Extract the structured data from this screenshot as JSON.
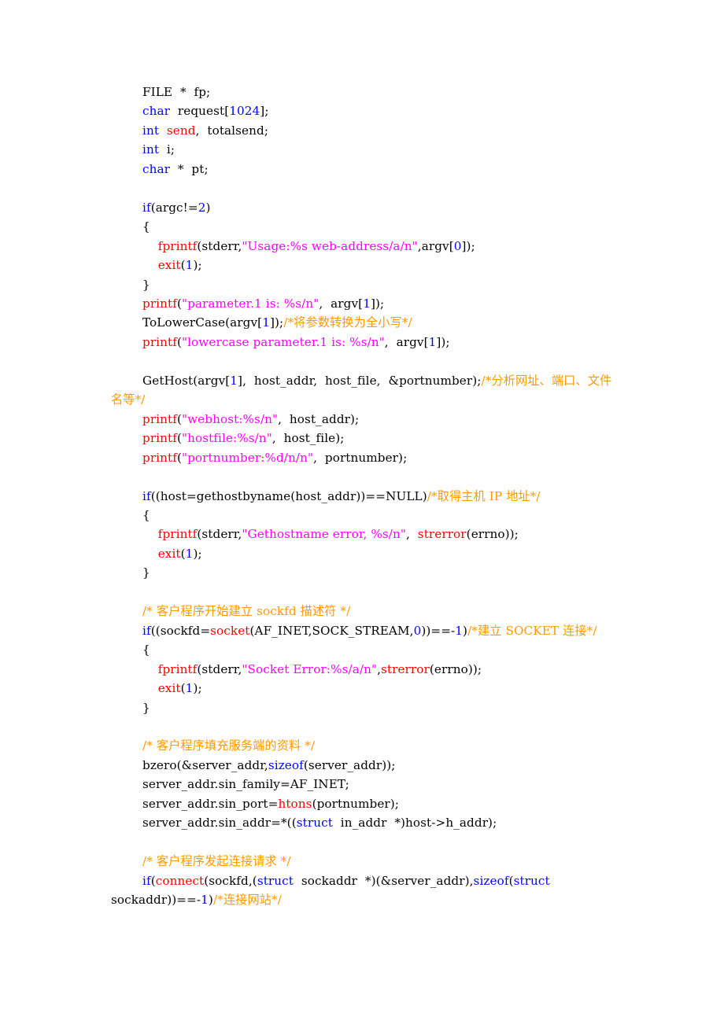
{
  "document": {
    "type": "c-source-code-listing",
    "language": "C",
    "colors": {
      "background": "#ffffff",
      "plain": "#000000",
      "keyword": "#0000ff",
      "function": "#ff0000",
      "string": "#ff00ff",
      "number": "#0000ff",
      "comment": "#ff9900",
      "constant": "#ff0000"
    }
  },
  "code": {
    "lines": [
      {
        "id": "l01",
        "tokens": [
          {
            "text": "FILE",
            "type": "const"
          },
          {
            "text": "  *  fp;",
            "type": "plain"
          }
        ]
      },
      {
        "id": "l02",
        "tokens": [
          {
            "text": "char",
            "type": "kw"
          },
          {
            "text": "  request[",
            "type": "plain"
          },
          {
            "text": "1024",
            "type": "num"
          },
          {
            "text": "];",
            "type": "plain"
          }
        ]
      },
      {
        "id": "l03",
        "tokens": [
          {
            "text": "int",
            "type": "kw"
          },
          {
            "text": "  ",
            "type": "plain"
          },
          {
            "text": "send",
            "type": "fn"
          },
          {
            "text": ",  totalsend;",
            "type": "plain"
          }
        ]
      },
      {
        "id": "l04",
        "tokens": [
          {
            "text": "int",
            "type": "kw"
          },
          {
            "text": "  i;",
            "type": "plain"
          }
        ]
      },
      {
        "id": "l05",
        "tokens": [
          {
            "text": "char",
            "type": "kw"
          },
          {
            "text": "  *  pt;",
            "type": "plain"
          }
        ]
      },
      {
        "id": "l06",
        "blank": true,
        "tokens": []
      },
      {
        "id": "l07",
        "tokens": [
          {
            "text": "if",
            "type": "kw"
          },
          {
            "text": "(argc!=",
            "type": "plain"
          },
          {
            "text": "2",
            "type": "num"
          },
          {
            "text": ")",
            "type": "plain"
          }
        ]
      },
      {
        "id": "l08",
        "tokens": [
          {
            "text": "{",
            "type": "plain"
          }
        ]
      },
      {
        "id": "l09",
        "tokens": [
          {
            "text": "    ",
            "type": "plain"
          },
          {
            "text": "fprintf",
            "type": "fn"
          },
          {
            "text": "(stderr,",
            "type": "plain"
          },
          {
            "text": "\"Usage:%s web-address/a/n\"",
            "type": "str"
          },
          {
            "text": ",argv[",
            "type": "plain"
          },
          {
            "text": "0",
            "type": "num"
          },
          {
            "text": "]);",
            "type": "plain"
          }
        ]
      },
      {
        "id": "l10",
        "tokens": [
          {
            "text": "    ",
            "type": "plain"
          },
          {
            "text": "exit",
            "type": "fn"
          },
          {
            "text": "(",
            "type": "plain"
          },
          {
            "text": "1",
            "type": "num"
          },
          {
            "text": ");",
            "type": "plain"
          }
        ]
      },
      {
        "id": "l11",
        "tokens": [
          {
            "text": "}",
            "type": "plain"
          }
        ]
      },
      {
        "id": "l12",
        "tokens": [
          {
            "text": "printf",
            "type": "fn"
          },
          {
            "text": "(",
            "type": "plain"
          },
          {
            "text": "\"parameter.1 is: %s/n\"",
            "type": "str"
          },
          {
            "text": ",  argv[",
            "type": "plain"
          },
          {
            "text": "1",
            "type": "num"
          },
          {
            "text": "]);",
            "type": "plain"
          }
        ]
      },
      {
        "id": "l13",
        "tokens": [
          {
            "text": "ToLowerCase(argv[",
            "type": "plain"
          },
          {
            "text": "1",
            "type": "num"
          },
          {
            "text": "]);",
            "type": "plain"
          },
          {
            "text": "/*将参数转换为全小写*/",
            "type": "comment"
          }
        ]
      },
      {
        "id": "l14",
        "tokens": [
          {
            "text": "printf",
            "type": "fn"
          },
          {
            "text": "(",
            "type": "plain"
          },
          {
            "text": "\"lowercase parameter.1 is: %s/n\"",
            "type": "str"
          },
          {
            "text": ",  argv[",
            "type": "plain"
          },
          {
            "text": "1",
            "type": "num"
          },
          {
            "text": "]);",
            "type": "plain"
          }
        ]
      },
      {
        "id": "l15",
        "blank": true,
        "tokens": []
      },
      {
        "id": "l16",
        "tokens": [
          {
            "text": "GetHost(argv[",
            "type": "plain"
          },
          {
            "text": "1",
            "type": "num"
          },
          {
            "text": "],  host_addr,  host_file,  &portnumber);",
            "type": "plain"
          },
          {
            "text": "/*分析网址、端口、文件名等*/",
            "type": "comment"
          }
        ]
      },
      {
        "id": "l17",
        "tokens": [
          {
            "text": "printf",
            "type": "fn"
          },
          {
            "text": "(",
            "type": "plain"
          },
          {
            "text": "\"webhost:%s/n\"",
            "type": "str"
          },
          {
            "text": ",  host_addr);",
            "type": "plain"
          }
        ]
      },
      {
        "id": "l18",
        "tokens": [
          {
            "text": "printf",
            "type": "fn"
          },
          {
            "text": "(",
            "type": "plain"
          },
          {
            "text": "\"hostfile:%s/n\"",
            "type": "str"
          },
          {
            "text": ",  host_file);",
            "type": "plain"
          }
        ]
      },
      {
        "id": "l19",
        "tokens": [
          {
            "text": "printf",
            "type": "fn"
          },
          {
            "text": "(",
            "type": "plain"
          },
          {
            "text": "\"portnumber:%d/n/n\"",
            "type": "str"
          },
          {
            "text": ",  portnumber);",
            "type": "plain"
          }
        ]
      },
      {
        "id": "l20",
        "blank": true,
        "tokens": []
      },
      {
        "id": "l21",
        "tokens": [
          {
            "text": "if",
            "type": "kw"
          },
          {
            "text": "((host=gethostbyname(host_addr))==",
            "type": "plain"
          },
          {
            "text": "NULL",
            "type": "const"
          },
          {
            "text": ")",
            "type": "plain"
          },
          {
            "text": "/*取得主机 IP 地址*/",
            "type": "comment"
          }
        ]
      },
      {
        "id": "l22",
        "tokens": [
          {
            "text": "{",
            "type": "plain"
          }
        ]
      },
      {
        "id": "l23",
        "tokens": [
          {
            "text": "    ",
            "type": "plain"
          },
          {
            "text": "fprintf",
            "type": "fn"
          },
          {
            "text": "(stderr,",
            "type": "plain"
          },
          {
            "text": "\"Gethostname error, %s/n\"",
            "type": "str"
          },
          {
            "text": ",  ",
            "type": "plain"
          },
          {
            "text": "strerror",
            "type": "fn"
          },
          {
            "text": "(errno));",
            "type": "plain"
          }
        ]
      },
      {
        "id": "l24",
        "tokens": [
          {
            "text": "    ",
            "type": "plain"
          },
          {
            "text": "exit",
            "type": "fn"
          },
          {
            "text": "(",
            "type": "plain"
          },
          {
            "text": "1",
            "type": "num"
          },
          {
            "text": ");",
            "type": "plain"
          }
        ]
      },
      {
        "id": "l25",
        "tokens": [
          {
            "text": "}",
            "type": "plain"
          }
        ]
      },
      {
        "id": "l26",
        "blank": true,
        "tokens": []
      },
      {
        "id": "l27",
        "tokens": [
          {
            "text": "/* 客户程序开始建立 sockfd 描述符 */",
            "type": "comment"
          }
        ]
      },
      {
        "id": "l28",
        "tokens": [
          {
            "text": "if",
            "type": "kw"
          },
          {
            "text": "((sockfd=",
            "type": "plain"
          },
          {
            "text": "socket",
            "type": "fn"
          },
          {
            "text": "(",
            "type": "plain"
          },
          {
            "text": "AF_INET",
            "type": "const"
          },
          {
            "text": ",",
            "type": "plain"
          },
          {
            "text": "SOCK_STREAM",
            "type": "const"
          },
          {
            "text": ",",
            "type": "plain"
          },
          {
            "text": "0",
            "type": "num"
          },
          {
            "text": "))==-",
            "type": "plain"
          },
          {
            "text": "1",
            "type": "num"
          },
          {
            "text": ")",
            "type": "plain"
          },
          {
            "text": "/*建立 SOCKET 连接*/",
            "type": "comment"
          }
        ]
      },
      {
        "id": "l29",
        "tokens": [
          {
            "text": "{",
            "type": "plain"
          }
        ]
      },
      {
        "id": "l30",
        "tokens": [
          {
            "text": "    ",
            "type": "plain"
          },
          {
            "text": "fprintf",
            "type": "fn"
          },
          {
            "text": "(stderr,",
            "type": "plain"
          },
          {
            "text": "\"Socket Error:%s/a/n\"",
            "type": "str"
          },
          {
            "text": ",",
            "type": "plain"
          },
          {
            "text": "strerror",
            "type": "fn"
          },
          {
            "text": "(errno));",
            "type": "plain"
          }
        ]
      },
      {
        "id": "l31",
        "tokens": [
          {
            "text": "    ",
            "type": "plain"
          },
          {
            "text": "exit",
            "type": "fn"
          },
          {
            "text": "(",
            "type": "plain"
          },
          {
            "text": "1",
            "type": "num"
          },
          {
            "text": ");",
            "type": "plain"
          }
        ]
      },
      {
        "id": "l32",
        "tokens": [
          {
            "text": "}",
            "type": "plain"
          }
        ]
      },
      {
        "id": "l33",
        "blank": true,
        "tokens": []
      },
      {
        "id": "l34",
        "tokens": [
          {
            "text": "/* 客户程序填充服务端的资料 */",
            "type": "comment"
          }
        ]
      },
      {
        "id": "l35",
        "tokens": [
          {
            "text": "bzero(&server_addr,",
            "type": "plain"
          },
          {
            "text": "sizeof",
            "type": "kw"
          },
          {
            "text": "(server_addr));",
            "type": "plain"
          }
        ]
      },
      {
        "id": "l36",
        "tokens": [
          {
            "text": "server_addr.sin_family=",
            "type": "plain"
          },
          {
            "text": "AF_INET",
            "type": "const"
          },
          {
            "text": ";",
            "type": "plain"
          }
        ]
      },
      {
        "id": "l37",
        "tokens": [
          {
            "text": "server_addr.sin_port=",
            "type": "plain"
          },
          {
            "text": "htons",
            "type": "fn"
          },
          {
            "text": "(portnumber);",
            "type": "plain"
          }
        ]
      },
      {
        "id": "l38",
        "tokens": [
          {
            "text": "server_addr.sin_addr=*((",
            "type": "plain"
          },
          {
            "text": "struct",
            "type": "kw"
          },
          {
            "text": "  ",
            "type": "plain"
          },
          {
            "text": "in_addr",
            "type": "const"
          },
          {
            "text": "  *)host->h_addr);",
            "type": "plain"
          }
        ]
      },
      {
        "id": "l39",
        "blank": true,
        "tokens": []
      },
      {
        "id": "l40",
        "tokens": [
          {
            "text": "/* 客户程序发起连接请求 */",
            "type": "comment"
          }
        ]
      },
      {
        "id": "l41",
        "tokens": [
          {
            "text": "if",
            "type": "kw"
          },
          {
            "text": "(",
            "type": "plain"
          },
          {
            "text": "connect",
            "type": "fn"
          },
          {
            "text": "(sockfd,(",
            "type": "plain"
          },
          {
            "text": "struct",
            "type": "kw"
          },
          {
            "text": "  ",
            "type": "plain"
          },
          {
            "text": "sockaddr",
            "type": "const"
          },
          {
            "text": "  *)(&server_addr),",
            "type": "plain"
          },
          {
            "text": "sizeof",
            "type": "kw"
          },
          {
            "text": "(",
            "type": "plain"
          },
          {
            "text": "struct",
            "type": "kw"
          },
          {
            "text": "  ",
            "type": "plain"
          },
          {
            "text": "sockaddr",
            "type": "const"
          },
          {
            "text": "))==-",
            "type": "plain"
          },
          {
            "text": "1",
            "type": "num"
          },
          {
            "text": ")",
            "type": "plain"
          },
          {
            "text": "/*连接网站*/",
            "type": "comment"
          }
        ]
      }
    ]
  }
}
